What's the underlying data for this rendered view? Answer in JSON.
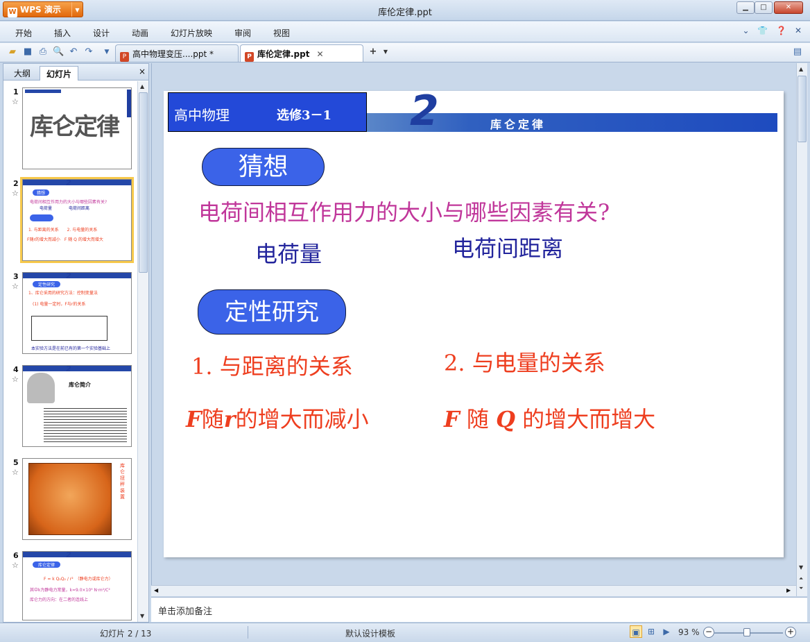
{
  "window": {
    "app_button": "WPS 演示",
    "title": "库伦定律.ppt"
  },
  "menu": [
    "开始",
    "插入",
    "设计",
    "动画",
    "幻灯片放映",
    "审阅",
    "视图"
  ],
  "tabs": [
    {
      "label": "高中物理变压....ppt *"
    },
    {
      "label": "库伦定律.ppt"
    }
  ],
  "panel": {
    "tab_outline": "大纲",
    "tab_slides": "幻灯片",
    "close": "×",
    "slides": [
      {
        "num": "1",
        "title": "库仑定律"
      },
      {
        "num": "2",
        "title": "猜想"
      },
      {
        "num": "3",
        "title": "定性研究"
      },
      {
        "num": "4",
        "title": "库仑简介"
      },
      {
        "num": "5",
        "title": "库仑扭秤装置"
      },
      {
        "num": "6",
        "title": "库仑定律"
      }
    ]
  },
  "slide": {
    "banner_left": "高中物理",
    "banner_left2": "选修3－1",
    "chapter_num": "2",
    "chapter_title": "库仑定律",
    "pill1": "猜想",
    "question": "电荷间相互作用力的大小与哪些因素有关?",
    "factor1": "电荷量",
    "factor2": "电荷间距离",
    "pill2": "定性研究",
    "rel1": "1. 与距离的关系",
    "rel2": "2. 与电量的关系",
    "res1_f": "F",
    "res1_mid": "随",
    "res1_r": "r",
    "res1_tail": "的增大而减小",
    "res2_f": "F",
    "res2_mid": " 随 ",
    "res2_q": "Q",
    "res2_tail": " 的增大而增大"
  },
  "notes_placeholder": "单击添加备注",
  "status": {
    "slide_count": "幻灯片 2 / 13",
    "template": "默认设计模板",
    "zoom": "93 %"
  },
  "colors": {
    "pill_blue": "#3b63e8",
    "question_magenta": "#c0369a",
    "factor_navy": "#22249c",
    "result_red": "#ee3e1f",
    "banner_blue": "#2349d8"
  }
}
